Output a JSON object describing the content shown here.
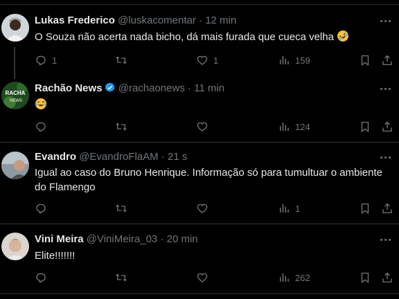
{
  "tweets": [
    {
      "name": "Lukas Frederico",
      "handle": "@luskacomentar",
      "separator": "·",
      "time": "12 min",
      "text": "O Souza não acerta nada bicho, dá mais furada que cueca velha",
      "emoji": "rolling-on-floor-laughing",
      "replies": "1",
      "likes": "1",
      "views": "159"
    },
    {
      "name": "Rachão News",
      "handle": "@rachaonews",
      "separator": "·",
      "time": "11 min",
      "verified": true,
      "avatar_text": "RACHA NEWS",
      "text": "",
      "emoji": "tears-of-joy",
      "views": "124"
    },
    {
      "name": "Evandro",
      "handle": "@EvandroFlaAM",
      "separator": "·",
      "time": "21 s",
      "text": "Igual ao caso do Bruno Henrique. Informação só para tumultuar o ambiente do Flamengo",
      "views": "1"
    },
    {
      "name": "Vini Meira",
      "handle": "@ViniMeira_03",
      "separator": "·",
      "time": "20 min",
      "text": "Elite!!!!!!!",
      "views": "262"
    }
  ],
  "colors": {
    "background": "#000000",
    "text": "#e7e9ea",
    "muted": "#71767b",
    "divider": "#2f3336",
    "verified": "#1d9bf0"
  }
}
